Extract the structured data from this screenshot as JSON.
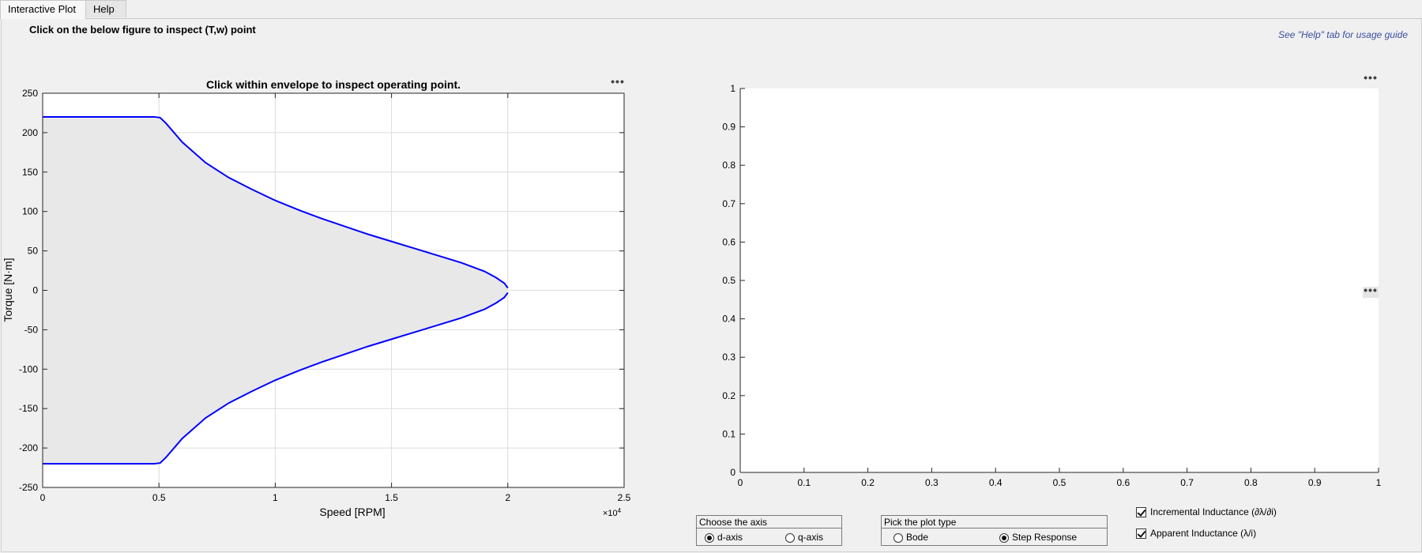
{
  "tabs": [
    {
      "label": "Interactive Plot",
      "active": true
    },
    {
      "label": "Help",
      "active": false
    }
  ],
  "instruction": "Click on the below figure to inspect (T,w) point",
  "help_link": "See \"Help\" tab for usage guide",
  "menu_dots": "•••",
  "chart_data": [
    {
      "type": "area",
      "title": "Click within envelope to inspect operating point.",
      "xlabel": "Speed [RPM]",
      "ylabel": "Torque [N·m]",
      "xlim": [
        0,
        25000
      ],
      "ylim": [
        -250,
        250
      ],
      "x_multiplier": "×10",
      "x_multiplier_exp": "4",
      "xtick_labels": [
        "0",
        "0.5",
        "1",
        "1.5",
        "2",
        "2.5"
      ],
      "ytick_labels": [
        "250",
        "200",
        "150",
        "100",
        "50",
        "0",
        "-50",
        "-100",
        "-150",
        "-200",
        "-250"
      ],
      "grid": true,
      "line_color": "#0000ff",
      "fill_color": "#e8e8e8",
      "series": [
        {
          "x": [
            0,
            4800,
            5050,
            5300,
            6000,
            7000,
            8000,
            9000,
            10000,
            11000,
            12000,
            13000,
            14000,
            15000,
            16000,
            17000,
            18000,
            19000,
            19500,
            19850,
            20000
          ],
          "y": [
            220,
            220,
            219,
            212,
            188,
            162,
            143,
            128,
            114,
            102,
            91,
            81,
            71,
            62,
            53,
            44,
            35,
            24,
            16,
            9,
            3
          ]
        },
        {
          "x": [
            0,
            4800,
            5050,
            5300,
            6000,
            7000,
            8000,
            9000,
            10000,
            11000,
            12000,
            13000,
            14000,
            15000,
            16000,
            17000,
            18000,
            19000,
            19500,
            19850,
            20000
          ],
          "y": [
            -220,
            -220,
            -219,
            -212,
            -188,
            -162,
            -143,
            -128,
            -114,
            -102,
            -91,
            -81,
            -71,
            -62,
            -53,
            -44,
            -35,
            -24,
            -16,
            -9,
            -3
          ]
        }
      ]
    },
    {
      "type": "line",
      "title": "",
      "xlim": [
        0,
        1
      ],
      "ylim": [
        0,
        1
      ],
      "xtick_labels": [
        "0",
        "0.1",
        "0.2",
        "0.3",
        "0.4",
        "0.5",
        "0.6",
        "0.7",
        "0.8",
        "0.9",
        "1"
      ],
      "ytick_labels": [
        "1",
        "0.9",
        "0.8",
        "0.7",
        "0.6",
        "0.5",
        "0.4",
        "0.3",
        "0.2",
        "0.1",
        "0"
      ],
      "grid": false,
      "series": []
    }
  ],
  "axis_group": {
    "title": "Choose the axis",
    "options": [
      {
        "label": "d-axis",
        "selected": true
      },
      {
        "label": "q-axis",
        "selected": false
      }
    ]
  },
  "plot_type_group": {
    "title": "Pick the plot type",
    "options": [
      {
        "label": "Bode",
        "selected": false
      },
      {
        "label": "Step Response",
        "selected": true
      }
    ]
  },
  "checkboxes": [
    {
      "label": "Incremental Inductance (∂λ/∂i)",
      "checked": true
    },
    {
      "label": "Apparent Inductance (λ/i)",
      "checked": true
    }
  ]
}
